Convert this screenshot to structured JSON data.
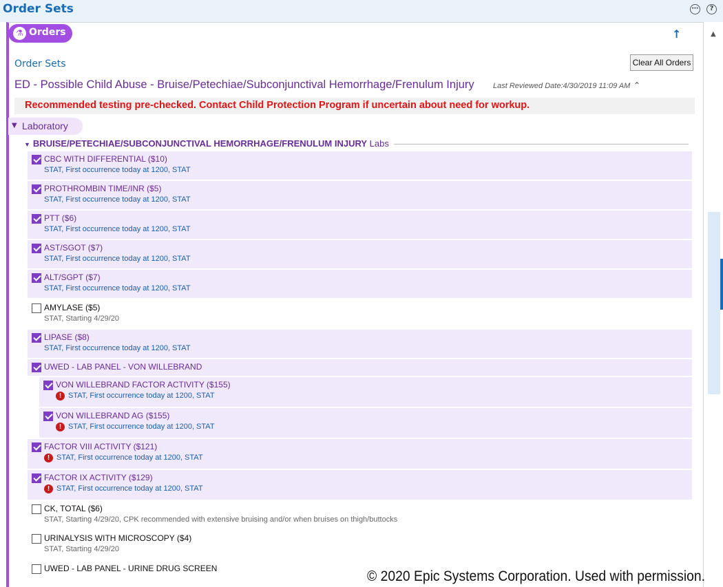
{
  "header": {
    "title": "Order Sets",
    "more_icon": "ellipsis-circle-icon",
    "help_icon": "question-circle-icon"
  },
  "orders_tab": {
    "label": "Orders",
    "icon": "orders-icon"
  },
  "order_sets_link": "Order Sets",
  "clear_all_label": "Clear All Orders",
  "order_set": {
    "title": "ED - Possible Child Abuse - Bruise/Petechiae/Subconjunctival Hemorrhage/Frenulum Injury",
    "last_reviewed": "Last Reviewed Date:4/30/2019 11:09 AM"
  },
  "banner_text": "Recommended testing pre-checked. Contact Child Protection Program if uncertain about need for workup.",
  "section": {
    "label": "Laboratory"
  },
  "group": {
    "title_bold": "BRUISE/PETECHIAE/SUBCONJUNCTIVAL HEMORRHAGE/FRENULUM INJURY",
    "title_rest": " Labs"
  },
  "orders": [
    {
      "name": "CBC WITH DIFFERENTIAL ($10)",
      "detail": "STAT, First occurrence today at 1200, STAT",
      "checked": true
    },
    {
      "name": "PROTHROMBIN TIME/INR ($5)",
      "detail": "STAT, First occurrence today at 1200, STAT",
      "checked": true
    },
    {
      "name": "PTT ($6)",
      "detail": "STAT, First occurrence today at 1200, STAT",
      "checked": true
    },
    {
      "name": "AST/SGOT ($7)",
      "detail": "STAT, First occurrence today at 1200, STAT",
      "checked": true
    },
    {
      "name": "ALT/SGPT ($7)",
      "detail": "STAT, First occurrence today at 1200, STAT",
      "checked": true
    },
    {
      "name": "AMYLASE ($5)",
      "detail": "STAT, Starting 4/29/20",
      "checked": false
    },
    {
      "name": "LIPASE ($8)",
      "detail": "STAT, First occurrence today at 1200, STAT",
      "checked": true
    },
    {
      "name": "UWED - LAB PANEL - VON WILLEBRAND",
      "detail": "",
      "checked": true
    },
    {
      "name": "VON WILLEBRAND FACTOR ACTIVITY ($155)",
      "detail": "STAT, First occurrence today at 1200, STAT",
      "checked": true,
      "warning": true
    },
    {
      "name": "VON WILLEBRAND AG ($155)",
      "detail": "STAT, First occurrence today at 1200, STAT",
      "checked": true,
      "warning": true
    },
    {
      "name": "FACTOR VIII ACTIVITY ($121)",
      "detail": "STAT, First occurrence today at 1200, STAT",
      "checked": true,
      "warning": true
    },
    {
      "name": "FACTOR IX ACTIVITY ($129)",
      "detail": "STAT, First occurrence today at 1200, STAT",
      "checked": true,
      "warning": true
    },
    {
      "name": "CK, TOTAL ($6)",
      "detail": "STAT, Starting 4/29/20, CPK recommended with extensive bruising and/or when bruises on thigh/buttocks",
      "checked": false
    },
    {
      "name": "URINALYSIS WITH MICROSCOPY ($4)",
      "detail": "STAT, Starting 4/29/20",
      "checked": false
    },
    {
      "name": "UWED - LAB PANEL - URINE DRUG SCREEN",
      "detail": "",
      "checked": false
    }
  ],
  "warning_glyph": "!",
  "copyright": "© 2020 Epic Systems Corporation. Used with permission."
}
